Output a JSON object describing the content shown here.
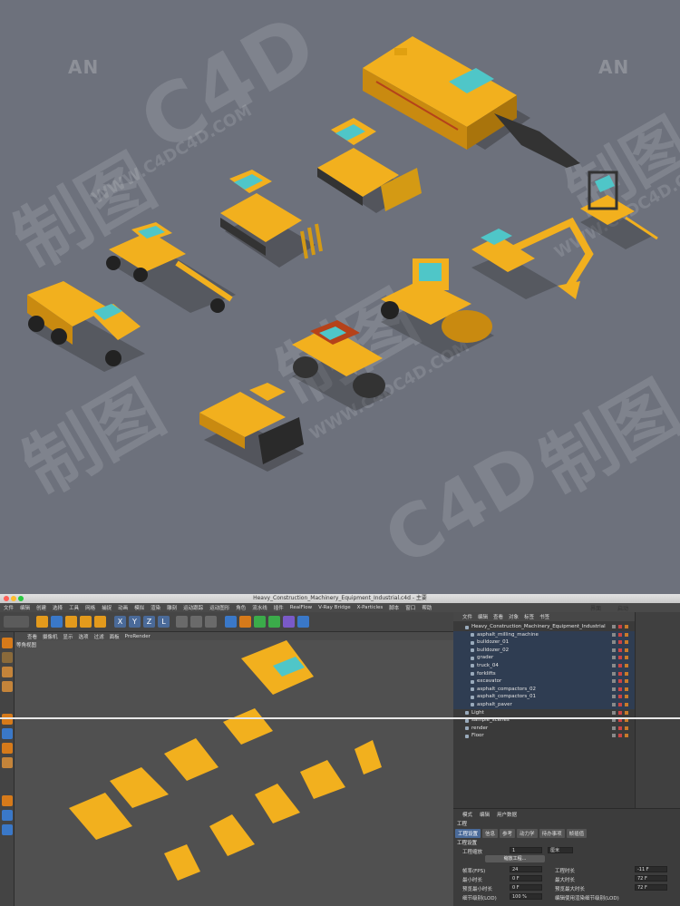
{
  "watermark": {
    "logo": "AN",
    "brand": "C4D",
    "url": "WWW.C4DC4D.COM",
    "cn": "制图"
  },
  "window": {
    "title": "Heavy_Construction_Machinery_Equipment_Industrial.c4d - 主要"
  },
  "menubar": [
    "文件",
    "编辑",
    "创建",
    "选择",
    "工具",
    "网格",
    "捕捉",
    "动画",
    "模拟",
    "渲染",
    "雕刻",
    "运动跟踪",
    "运动图形",
    "角色",
    "流水线",
    "插件",
    "RealFlow",
    "V-Ray Bridge",
    "X-Particles",
    "脚本",
    "窗口",
    "帮助"
  ],
  "right_header": {
    "layout_label": "界面",
    "layout_value": "启动"
  },
  "viewport": {
    "menu": [
      "查看",
      "摄像机",
      "显示",
      "选项",
      "过滤",
      "面板",
      "ProRender"
    ],
    "label": "等角视图"
  },
  "object_manager": {
    "menu": [
      "文件",
      "编辑",
      "查看",
      "对象",
      "标签",
      "书签"
    ],
    "objects": [
      {
        "name": "Heavy_Construction_Machinery_Equipment_Industrial",
        "level": 0
      },
      {
        "name": "asphalt_milling_machine",
        "level": 1
      },
      {
        "name": "bulldozer_01",
        "level": 1
      },
      {
        "name": "bulldozer_02",
        "level": 1
      },
      {
        "name": "grader",
        "level": 1
      },
      {
        "name": "truck_04",
        "level": 1
      },
      {
        "name": "forklifts",
        "level": 1
      },
      {
        "name": "excavator",
        "level": 1
      },
      {
        "name": "asphalt_compactors_02",
        "level": 1
      },
      {
        "name": "asphalt_compactors_01",
        "level": 1
      },
      {
        "name": "asphalt_paver",
        "level": 1
      },
      {
        "name": "Light",
        "level": 0
      },
      {
        "name": "sample_scenes",
        "level": 0
      },
      {
        "name": "render",
        "level": 0
      },
      {
        "name": "Floor",
        "level": 0
      }
    ]
  },
  "attributes": {
    "menu": [
      "模式",
      "编辑",
      "用户数据"
    ],
    "title": "工程",
    "tabs": [
      "工程设置",
      "信息",
      "参考",
      "动力学",
      "待办事项",
      "帧插值"
    ],
    "section": "工程设置",
    "scale_label": "工程缩放",
    "scale_value": "1",
    "scale_unit": "厘米",
    "scale_button": "缩放工程...",
    "fields": [
      {
        "label": "帧率(FPS)",
        "value": "24",
        "label2": "工程时长",
        "value2": "-11 F"
      },
      {
        "label": "最小时长",
        "value": "0 F",
        "label2": "最大时长",
        "value2": "72 F"
      },
      {
        "label": "预览最小时长",
        "value": "0 F",
        "label2": "预览最大时长",
        "value2": "72 F"
      },
      {
        "label": "细节级别(LOD)",
        "value": "100 %",
        "label2": "编辑使用渲染细节级别(LOD)",
        "value2": ""
      }
    ]
  },
  "colors": {
    "hero_bg": "#6d717c",
    "machine_yellow": "#f2b01e",
    "cab_glass": "#4fc6c8",
    "ui_dark": "#3b3b3b",
    "selection_blue": "#4a6a99"
  }
}
